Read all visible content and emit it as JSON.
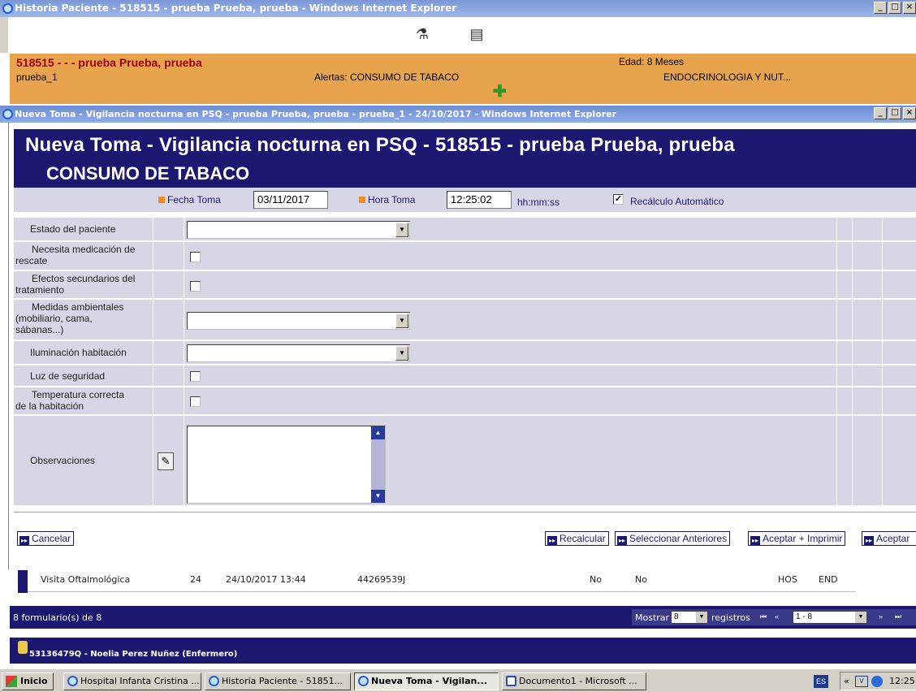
{
  "outer_window": {
    "title": "Historia Paciente - 518515 - prueba Prueba, prueba - Windows Internet Explorer"
  },
  "patient": {
    "name": "518515 - - - prueba Prueba, prueba",
    "user": "prueba_1",
    "alert": "Alertas: CONSUMO DE TABACO",
    "age": "Edad: 8 Meses",
    "service": "ENDOCRINOLOGIA Y NUT..."
  },
  "inner_window": {
    "title": "Nueva Toma - Vigilancia nocturna en PSQ - prueba Prueba, prueba - prueba_1 - 24/10/2017 - Windows Internet Explorer"
  },
  "form": {
    "title": "Nueva Toma - Vigilancia nocturna en PSQ - 518515 - prueba Prueba, prueba",
    "subtitle": "CONSUMO DE TABACO",
    "fecha_label": "Fecha Toma",
    "fecha_value": "03/11/2017",
    "hora_label": "Hora Toma",
    "hora_value": "12:25:02",
    "hora_format": "hh:mm:ss",
    "recalc_label": "Recálculo Automático",
    "recalc_checked": true,
    "fields": {
      "estado": "Estado del paciente",
      "necesita_1": "Necesita medicación de",
      "necesita_2": "rescate",
      "efectos_1": "Efectos secundarios del",
      "efectos_2": "tratamiento",
      "medidas_1": "Medidas ambientales",
      "medidas_2": "(mobiliario, cama,",
      "medidas_3": "sábanas...)",
      "iluminacion": "Iluminación habitación",
      "luz": "Luz de seguridad",
      "temperatura_1": "Temperatura correcta",
      "temperatura_2": "de la habitación",
      "observaciones": "Observaciones"
    }
  },
  "buttons": {
    "cancelar": "Cancelar",
    "recalcular": "Recalcular",
    "seleccionar": "Seleccionar Anteriores",
    "aceptar_imprimir": "Aceptar + Imprimir",
    "aceptar": "Aceptar"
  },
  "list": {
    "row": {
      "name": "Visita Oftalmológica",
      "num": "24",
      "date": "24/10/2017 13:44",
      "code": "44269539J",
      "c1": "No",
      "c2": "No",
      "c3": "HOS",
      "c4": "END"
    },
    "count": "8 formulario(s) de 8",
    "mostrar": "Mostrar",
    "per_page": "8",
    "registros": "registros",
    "range": "1 - 8"
  },
  "user_bar": {
    "text": "53136479Q - Noelia Perez Nuñez (Enfermero)"
  },
  "taskbar": {
    "start": "Inicio",
    "tasks": [
      "Hospital Infanta Cristina ...",
      "Historia Paciente - 51851...",
      "Nueva Toma - Vigilan...",
      "Documento1 - Microsoft ..."
    ],
    "lang": "ES",
    "clock": "12:25"
  }
}
